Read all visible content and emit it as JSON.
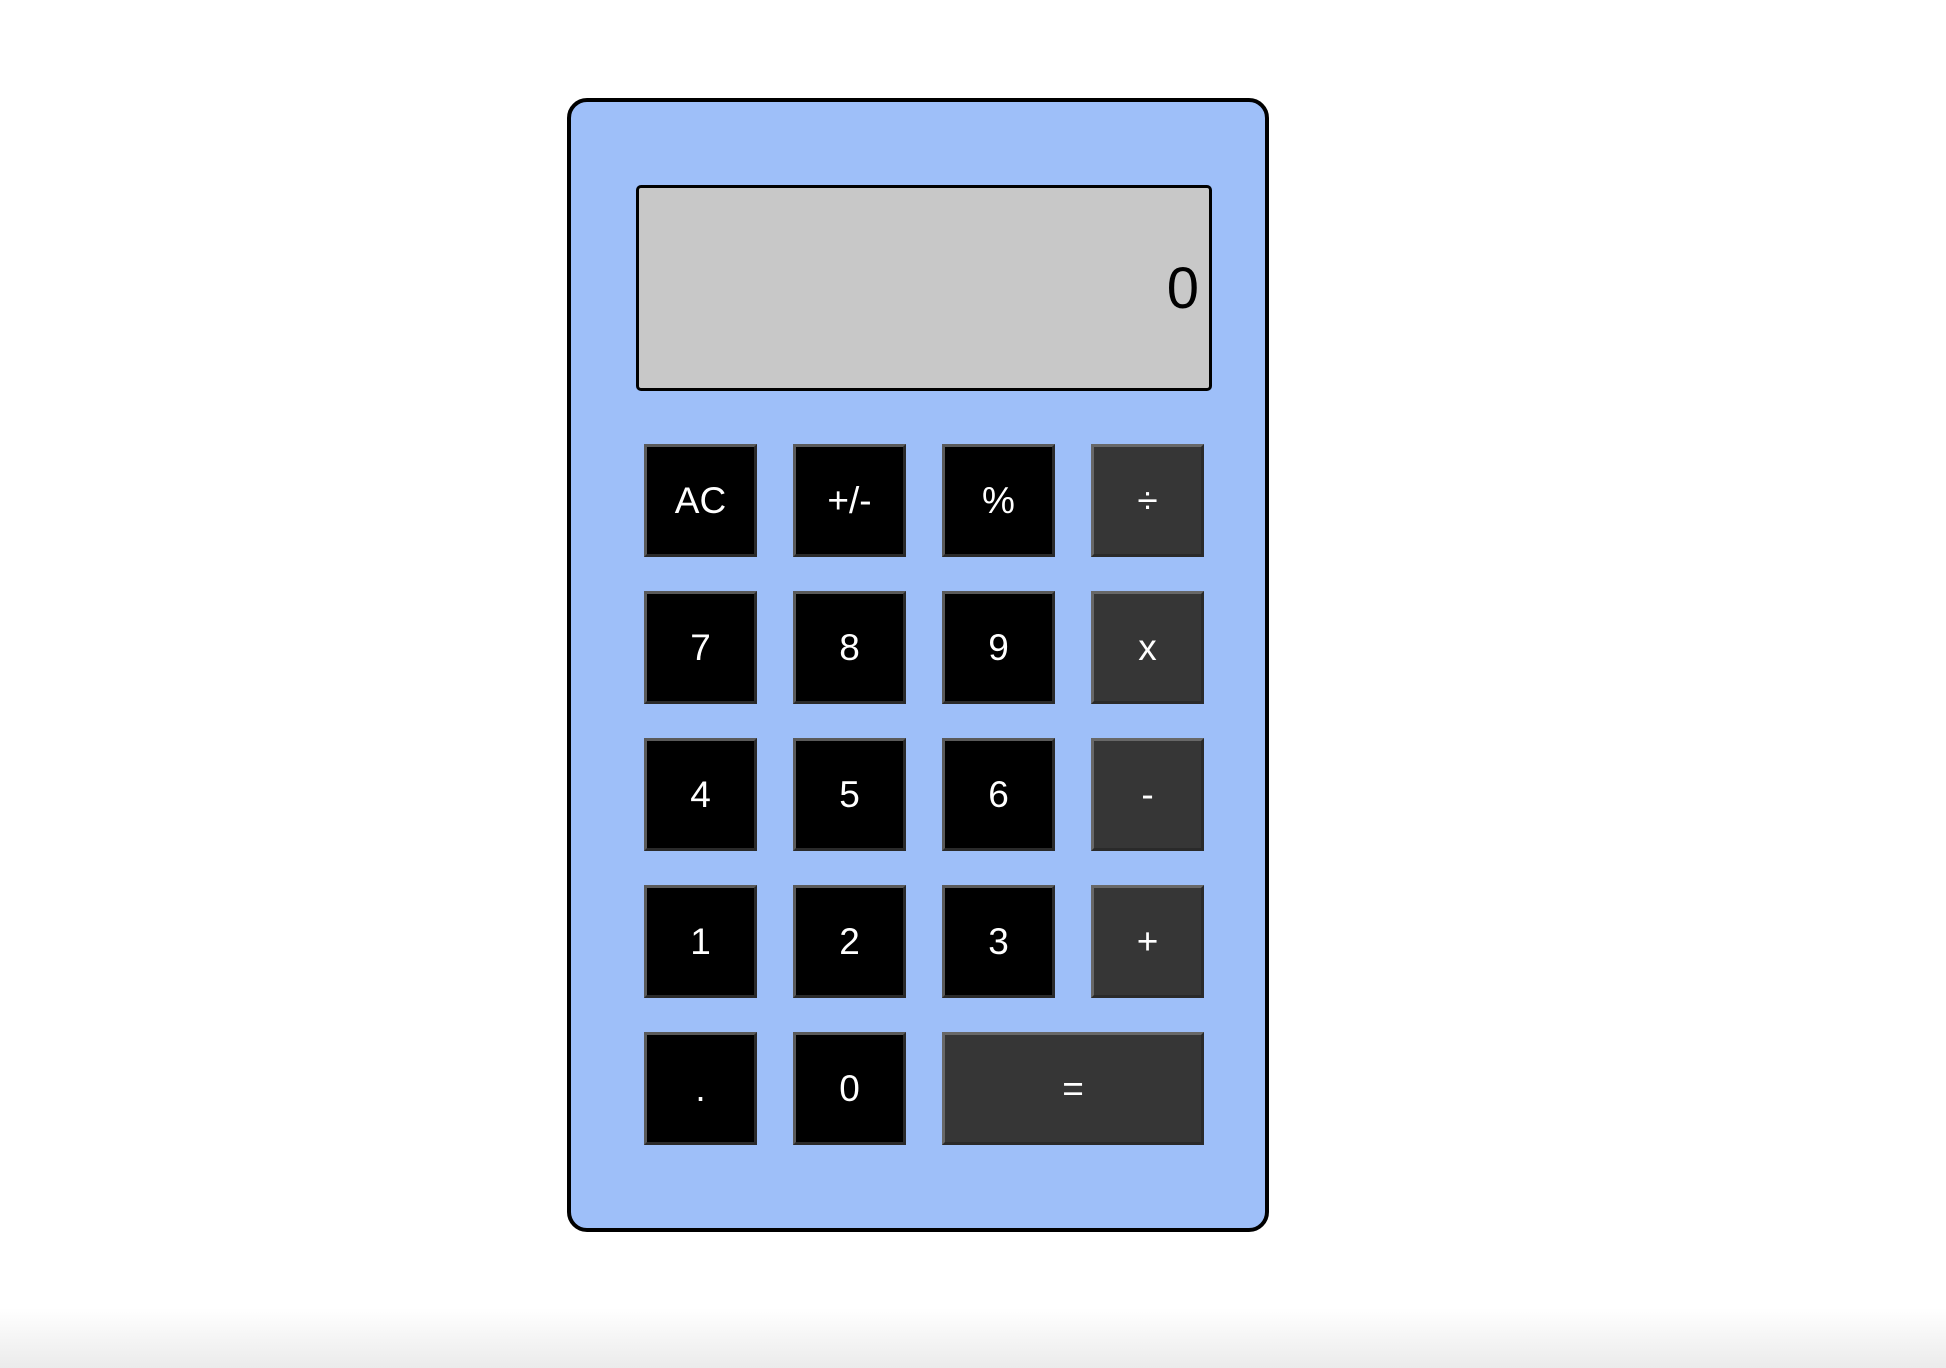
{
  "calculator": {
    "display_value": "0",
    "colors": {
      "body": "#9ebff9",
      "display": "#c8c8c8",
      "number_key": "#000000",
      "operator_key": "#363636",
      "key_text": "#ffffff"
    },
    "keys": {
      "ac": "AC",
      "plus_minus": "+/-",
      "percent": "%",
      "divide": "÷",
      "seven": "7",
      "eight": "8",
      "nine": "9",
      "multiply": "x",
      "four": "4",
      "five": "5",
      "six": "6",
      "subtract": "-",
      "one": "1",
      "two": "2",
      "three": "3",
      "add": "+",
      "decimal": ".",
      "zero": "0",
      "equals": "="
    }
  }
}
